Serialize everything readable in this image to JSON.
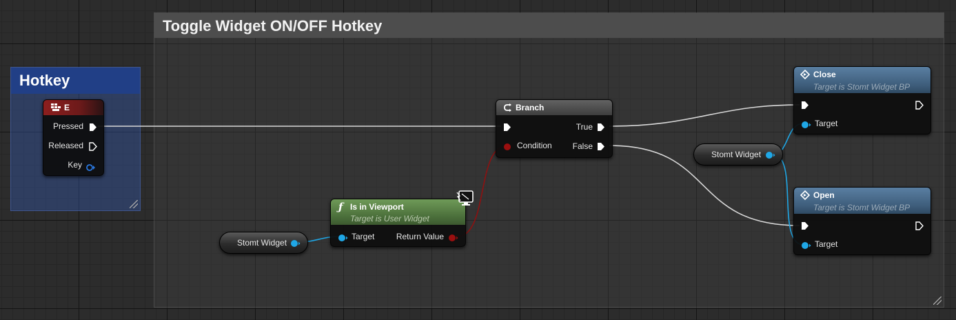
{
  "comments": {
    "main_title": "Toggle Widget ON/OFF Hotkey",
    "hotkey_title": "Hotkey"
  },
  "key_event_node": {
    "title": "E",
    "pins": {
      "pressed": "Pressed",
      "released": "Released",
      "key": "Key"
    }
  },
  "branch_node": {
    "title": "Branch",
    "pins": {
      "condition": "Condition",
      "true": "True",
      "false": "False"
    }
  },
  "is_in_viewport_node": {
    "title": "Is in Viewport",
    "subtitle": "Target is User Widget",
    "pins": {
      "target": "Target",
      "return_value": "Return Value"
    }
  },
  "stomt_widget_var_1": {
    "label": "Stomt Widget"
  },
  "stomt_widget_var_2": {
    "label": "Stomt Widget"
  },
  "close_node": {
    "title": "Close",
    "subtitle": "Target is Stomt Widget BP",
    "pins": {
      "target": "Target"
    }
  },
  "open_node": {
    "title": "Open",
    "subtitle": "Target is Stomt Widget BP",
    "pins": {
      "target": "Target"
    }
  },
  "colors": {
    "exec_wire": "#d8d8d8",
    "object_pin": "#1fa7e6",
    "bool_pin": "#9a0f0f",
    "key_header": "#8c1e1e",
    "pure_function_header": "#5f8a48",
    "function_header": "#486c8c",
    "branch_header": "#4e4e4e"
  },
  "icons": {
    "key_event": "keyboard-key-icon",
    "branch": "branch-icon",
    "function": "function-icon",
    "call": "diamond-call-icon",
    "client_only": "monitor-icon"
  }
}
